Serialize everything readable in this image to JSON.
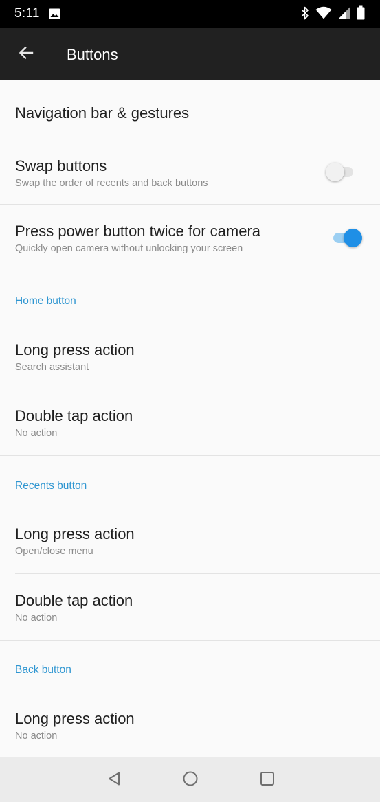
{
  "status_bar": {
    "time": "5:11",
    "icons": [
      "image-icon",
      "bluetooth-icon",
      "wifi-icon",
      "signal-icon",
      "battery-icon"
    ]
  },
  "app_bar": {
    "title": "Buttons",
    "back_icon": "arrow-back-icon"
  },
  "settings": {
    "nav_bar_gestures": {
      "title": "Navigation bar & gestures"
    },
    "swap_buttons": {
      "title": "Swap buttons",
      "summary": "Swap the order of recents and back buttons",
      "enabled": false
    },
    "power_camera": {
      "title": "Press power button twice for camera",
      "summary": "Quickly open camera without unlocking your screen",
      "enabled": true
    },
    "home_button": {
      "header": "Home button",
      "long_press": {
        "title": "Long press action",
        "summary": "Search assistant"
      },
      "double_tap": {
        "title": "Double tap action",
        "summary": "No action"
      }
    },
    "recents_button": {
      "header": "Recents button",
      "long_press": {
        "title": "Long press action",
        "summary": "Open/close menu"
      },
      "double_tap": {
        "title": "Double tap action",
        "summary": "No action"
      }
    },
    "back_button": {
      "header": "Back button",
      "long_press": {
        "title": "Long press action",
        "summary": "No action"
      }
    }
  },
  "colors": {
    "accent": "#2f96d1",
    "toggle_on_thumb": "#1f8fe6",
    "toggle_on_track": "#9ccff2",
    "app_bar": "#212121",
    "status_bar": "#000000",
    "background": "#fafafa",
    "nav_bar": "#ebebeb"
  },
  "nav_bar": {
    "buttons": [
      "back-triangle-icon",
      "home-circle-icon",
      "recents-square-icon"
    ]
  }
}
